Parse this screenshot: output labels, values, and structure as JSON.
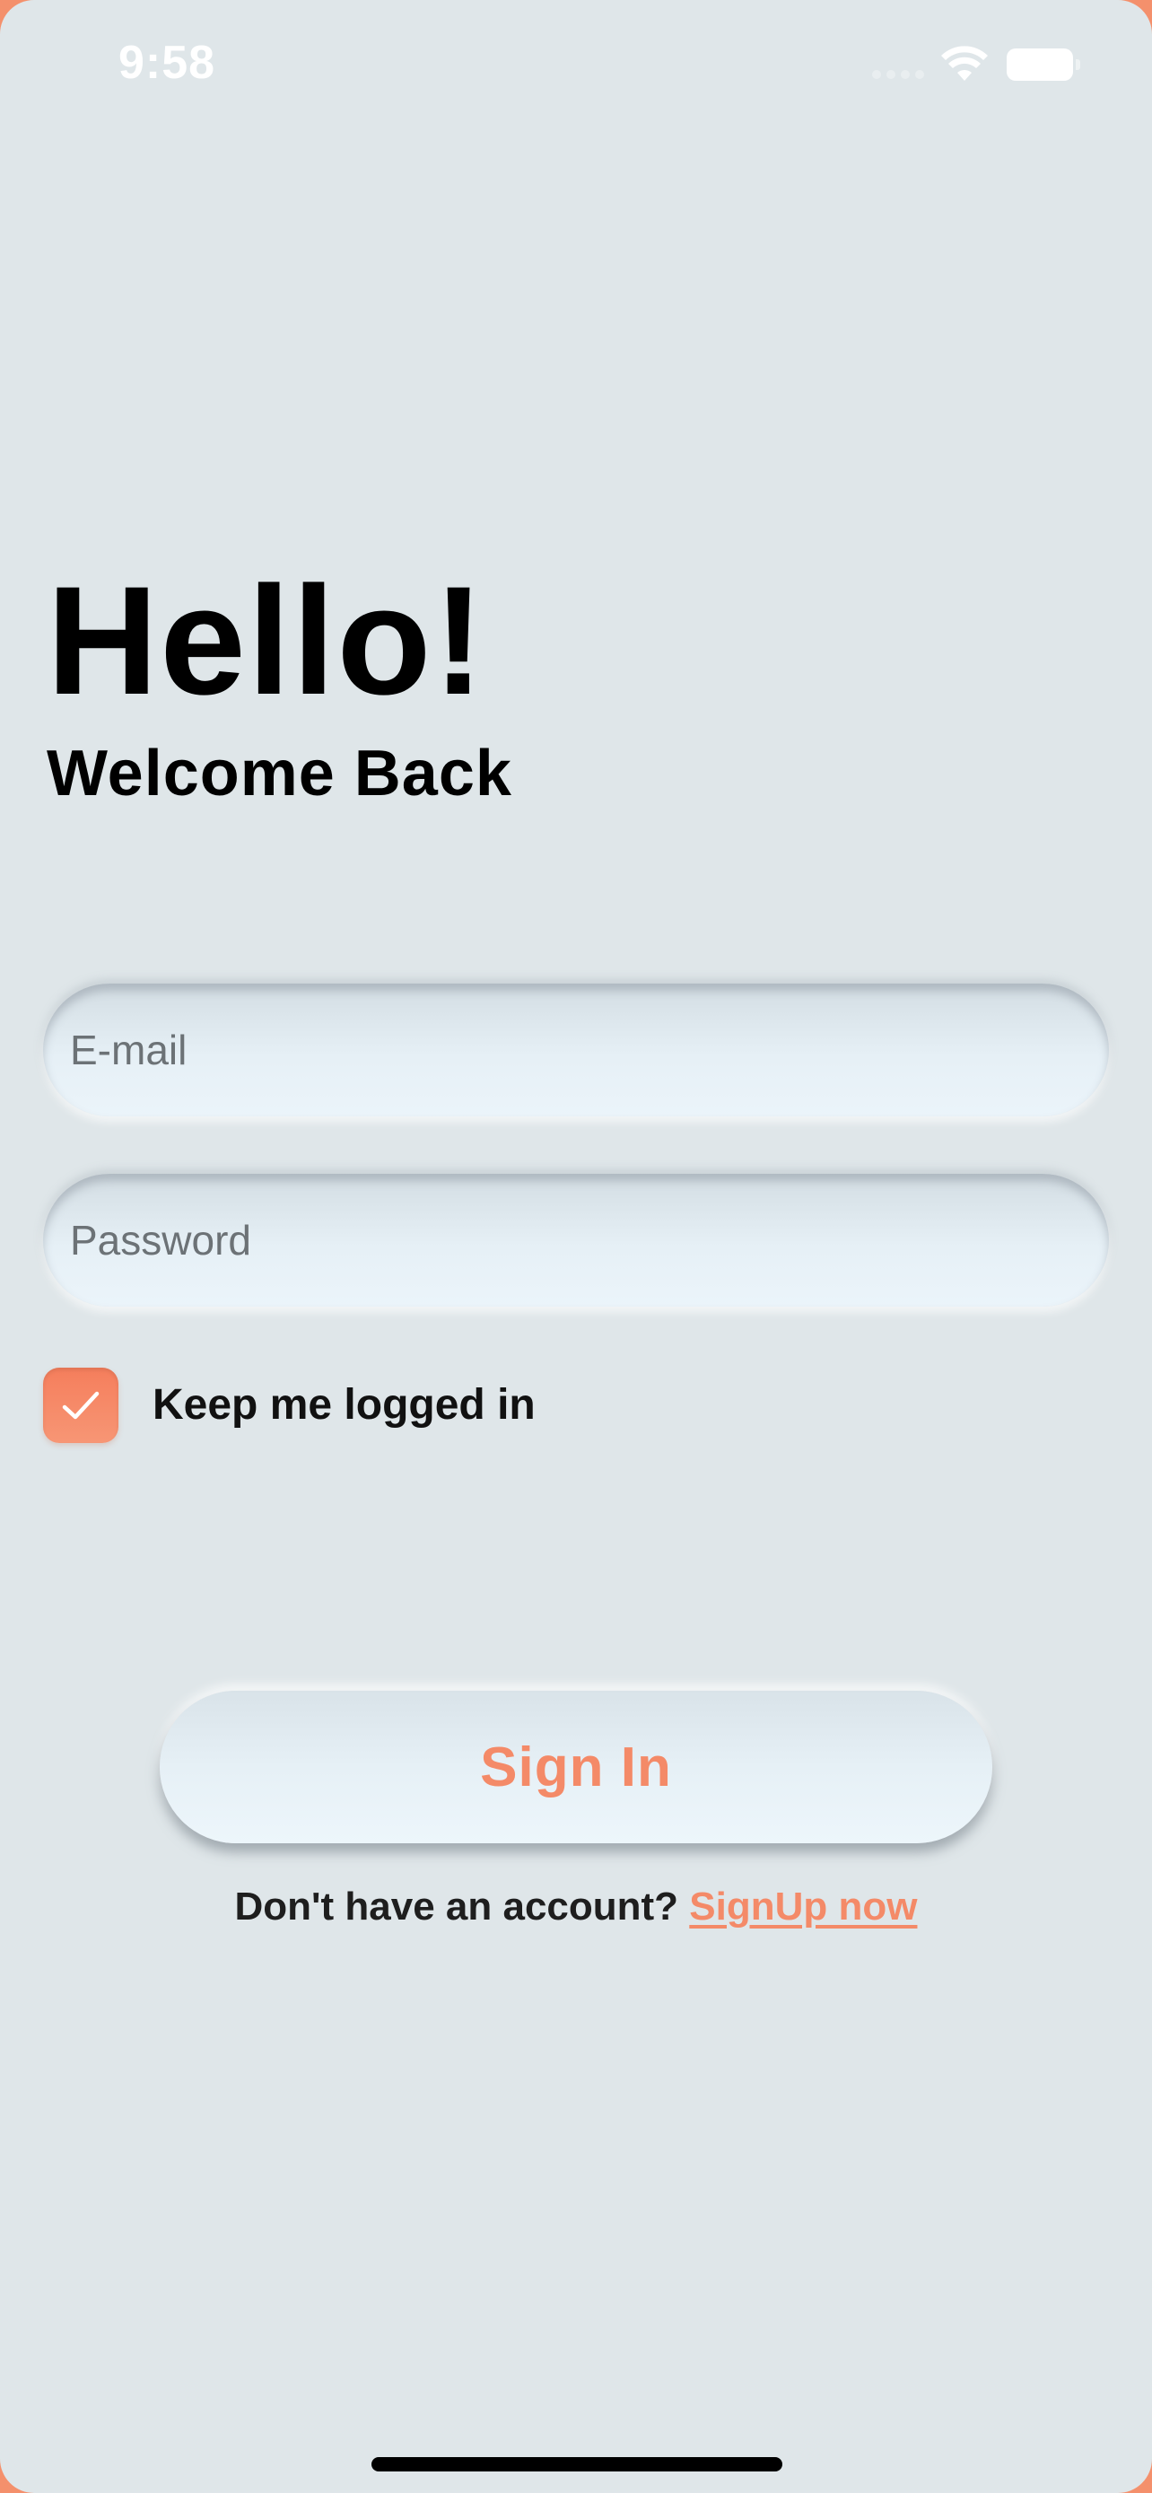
{
  "status_bar": {
    "time": "9:58"
  },
  "greeting": {
    "title": "Hello!",
    "subtitle": "Welcome Back"
  },
  "form": {
    "email_placeholder": "E-mail",
    "password_placeholder": "Password",
    "keep_logged_in_label": "Keep me logged in",
    "keep_logged_in_checked": true
  },
  "actions": {
    "sign_in_label": "Sign In",
    "signup_prompt": "Don't have an account?",
    "signup_link": "SignUp now"
  },
  "colors": {
    "background": "#dfe6e9",
    "accent": "#f48a68"
  },
  "icons": [
    "signal-icon",
    "wifi-icon",
    "battery-icon",
    "checkmark-icon"
  ]
}
